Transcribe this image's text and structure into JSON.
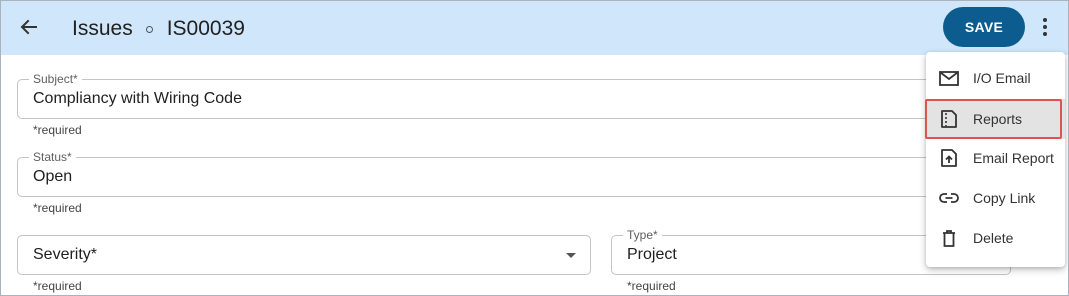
{
  "header": {
    "section": "Issues",
    "record_id": "IS00039",
    "save_label": "SAVE",
    "back_icon": "arrow-left-icon",
    "more_icon": "more-vert-icon",
    "colors": {
      "header_bg": "#cfe6fb",
      "save_bg": "#0c5c8f",
      "highlight": "#e05252"
    }
  },
  "form": {
    "subject": {
      "label": "Subject*",
      "value": "Compliancy with Wiring Code",
      "helper": "*required"
    },
    "status": {
      "label": "Status*",
      "value": "Open",
      "helper": "*required"
    },
    "severity": {
      "placeholder": "Severity*",
      "helper": "*required"
    },
    "type": {
      "label": "Type*",
      "value": "Project",
      "helper": "*required"
    }
  },
  "menu": {
    "items": [
      {
        "label": "I/O Email",
        "icon": "mail-icon"
      },
      {
        "label": "Reports",
        "icon": "report-icon",
        "selected": true
      },
      {
        "label": "Email Report",
        "icon": "upload-file-icon"
      },
      {
        "label": "Copy Link",
        "icon": "link-icon"
      },
      {
        "label": "Delete",
        "icon": "trash-icon"
      }
    ]
  }
}
